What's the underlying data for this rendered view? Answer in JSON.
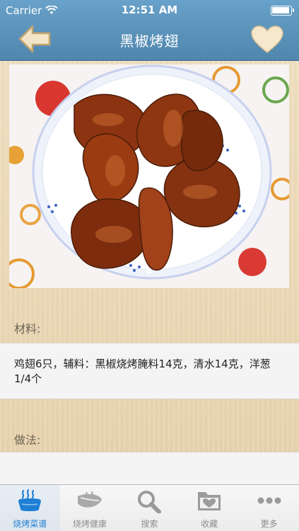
{
  "status_bar": {
    "carrier": "Carrier",
    "time": "12:51 AM"
  },
  "nav": {
    "title": "黑椒烤翅",
    "back_icon": "back-arrow-icon",
    "favorite_icon": "heart-icon"
  },
  "recipe": {
    "photo_alt": "黑椒烤翅",
    "materials_label": "材料:",
    "materials_text": "鸡翅6只，辅料：黑椒烧烤腌料14克，清水14克，洋葱1/4个",
    "method_label": "做法:",
    "method_text": ""
  },
  "tabs": [
    {
      "label": "烧烤菜谱",
      "icon": "grill-icon",
      "active": true
    },
    {
      "label": "烧烤健康",
      "icon": "health-icon",
      "active": false
    },
    {
      "label": "搜索",
      "icon": "search-icon",
      "active": false
    },
    {
      "label": "收藏",
      "icon": "favorites-folder-icon",
      "active": false
    },
    {
      "label": "更多",
      "icon": "more-dots-icon",
      "active": false
    }
  ],
  "colors": {
    "nav_bar": "#5a90b8",
    "tab_active": "#1f7fd4",
    "background": "#ead7b5"
  }
}
